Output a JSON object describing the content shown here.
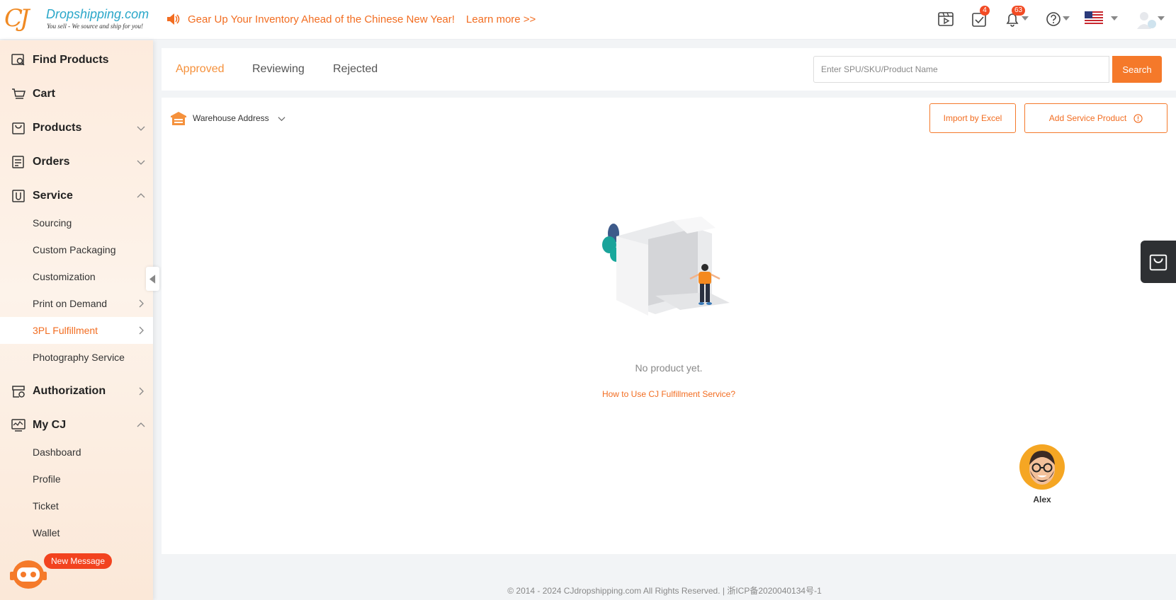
{
  "logo": {
    "cj": "CJ",
    "name": "Dropshipping.com",
    "tagline": "You sell - We source and ship for you!"
  },
  "announcement": {
    "text": "Gear Up Your Inventory Ahead of the Chinese New Year!",
    "link": "Learn more >>"
  },
  "header_icons": {
    "tasks_badge": "4",
    "notifications_badge": "63"
  },
  "sidebar": {
    "items": [
      {
        "label": "Find Products"
      },
      {
        "label": "Cart"
      },
      {
        "label": "Products"
      },
      {
        "label": "Orders"
      },
      {
        "label": "Service"
      },
      {
        "label": "Authorization"
      },
      {
        "label": "My CJ"
      }
    ],
    "service_sub": [
      "Sourcing",
      "Custom Packaging",
      "Customization",
      "Print on Demand",
      "3PL Fulfillment",
      "Photography Service"
    ],
    "mycj_sub": [
      "Dashboard",
      "Profile",
      "Ticket",
      "Wallet"
    ],
    "new_message": "New Message"
  },
  "tabs": [
    "Approved",
    "Reviewing",
    "Rejected"
  ],
  "search": {
    "placeholder": "Enter SPU/SKU/Product Name",
    "button": "Search"
  },
  "content": {
    "warehouse_label": "Warehouse Address",
    "import_button": "Import by Excel",
    "add_button": "Add Service Product",
    "empty_text": "No product yet.",
    "help_link": "How to Use CJ Fulfillment Service?",
    "agent_name": "Alex"
  },
  "footer": "©  2014 - 2024 CJdropshipping.com All Rights Reserved.     |     浙ICP备2020040134号-1",
  "colors": {
    "accent": "#f26d21",
    "button": "#f5792a",
    "badge": "#f24b24"
  }
}
